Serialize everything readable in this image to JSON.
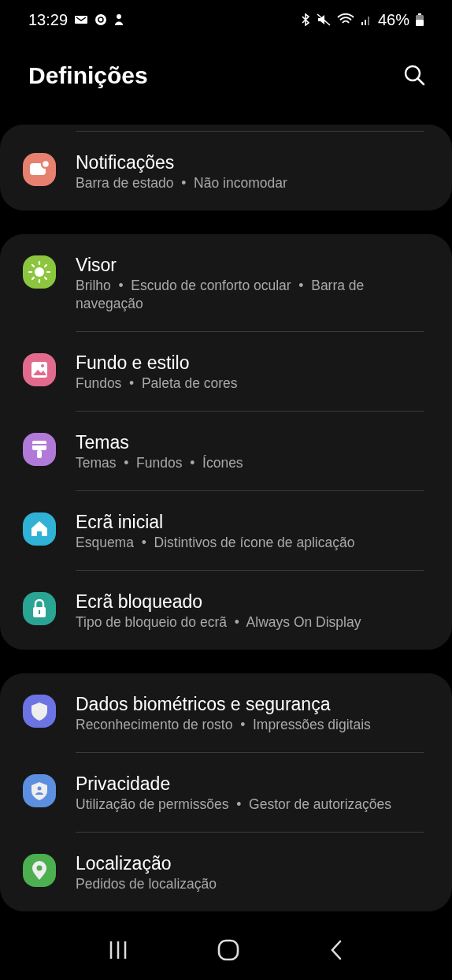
{
  "status_bar": {
    "time": "13:29",
    "battery": "46%"
  },
  "header": {
    "title": "Definições"
  },
  "cards": [
    {
      "items": [
        {
          "kind": "notifications",
          "color": "#e8806f",
          "title": "Notificações",
          "subtitle": "Barra de estado  •  Não incomodar"
        }
      ]
    },
    {
      "items": [
        {
          "kind": "display",
          "color": "#8cc63f",
          "title": "Visor",
          "subtitle": "Brilho  •  Escudo de conforto ocular  •  Barra de navegação"
        },
        {
          "kind": "wallpaper",
          "color": "#e26b8d",
          "title": "Fundo e estilo",
          "subtitle": "Fundos  •  Paleta de cores"
        },
        {
          "kind": "themes",
          "color": "#b27ad8",
          "title": "Temas",
          "subtitle": "Temas  •  Fundos  •  Ícones"
        },
        {
          "kind": "home",
          "color": "#2fb2d6",
          "title": "Ecrã inicial",
          "subtitle": "Esquema  •  Distintivos de ícone de aplicação"
        },
        {
          "kind": "lock",
          "color": "#2aa593",
          "title": "Ecrã bloqueado",
          "subtitle": "Tipo de bloqueio do ecrã  •  Always On Display"
        }
      ]
    },
    {
      "items": [
        {
          "kind": "security",
          "color": "#6b74e2",
          "title": "Dados biométricos e segurança",
          "subtitle": "Reconhecimento de rosto  •  Impressões digitais"
        },
        {
          "kind": "privacy",
          "color": "#5d8fe0",
          "title": "Privacidade",
          "subtitle": "Utilização de permissões  •  Gestor de autorizações"
        },
        {
          "kind": "location",
          "color": "#4caf50",
          "title": "Localização",
          "subtitle": "Pedidos de localização"
        }
      ]
    }
  ]
}
